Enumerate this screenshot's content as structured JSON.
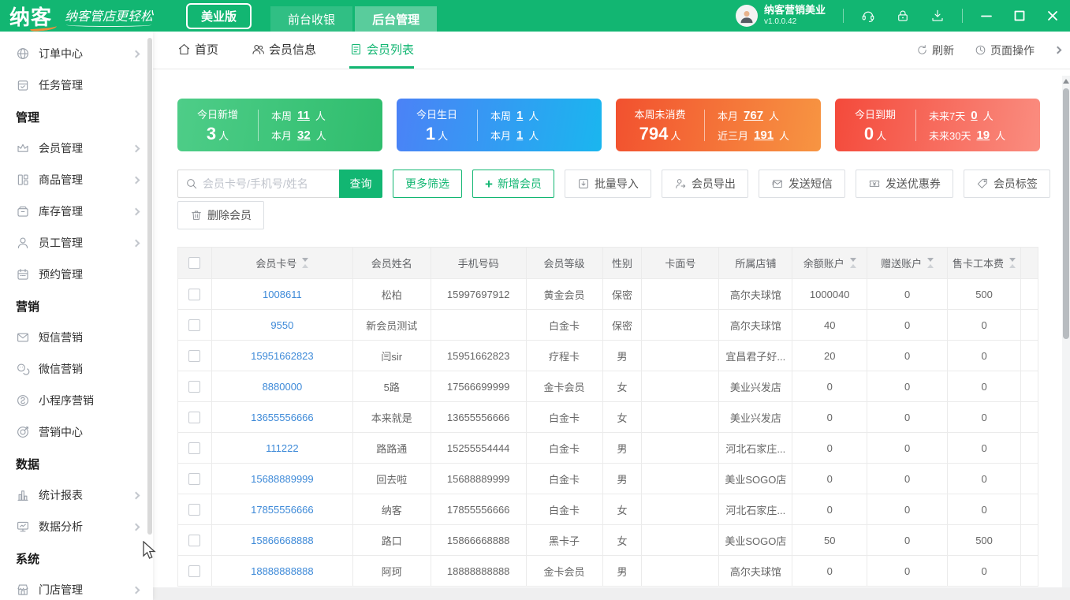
{
  "header": {
    "logo": "纳客",
    "slogan": "纳客管店更轻松",
    "edition_badge": "美业版",
    "nav_tabs": [
      {
        "label": "前台收银",
        "active": false
      },
      {
        "label": "后台管理",
        "active": true
      }
    ],
    "user": {
      "name": "纳客营销美业",
      "version": "v1.0.0.42"
    }
  },
  "sidebar": {
    "items": [
      {
        "label": "订单中心",
        "icon": "globe-icon",
        "type": "item",
        "arrow": true
      },
      {
        "label": "任务管理",
        "icon": "task-icon",
        "type": "item",
        "arrow": false
      },
      {
        "label": "管理",
        "type": "section"
      },
      {
        "label": "会员管理",
        "icon": "crown-icon",
        "type": "item",
        "arrow": true
      },
      {
        "label": "商品管理",
        "icon": "goods-icon",
        "type": "item",
        "arrow": true
      },
      {
        "label": "库存管理",
        "icon": "inventory-icon",
        "type": "item",
        "arrow": true
      },
      {
        "label": "员工管理",
        "icon": "person-icon",
        "type": "item",
        "arrow": true
      },
      {
        "label": "预约管理",
        "icon": "calendar-icon",
        "type": "item",
        "arrow": false
      },
      {
        "label": "营销",
        "type": "section"
      },
      {
        "label": "短信营销",
        "icon": "mail-icon",
        "type": "item",
        "arrow": false
      },
      {
        "label": "微信营销",
        "icon": "wechat-icon",
        "type": "item",
        "arrow": false
      },
      {
        "label": "小程序营销",
        "icon": "miniapp-icon",
        "type": "item",
        "arrow": false
      },
      {
        "label": "营销中心",
        "icon": "target-icon",
        "type": "item",
        "arrow": false
      },
      {
        "label": "数据",
        "type": "section"
      },
      {
        "label": "统计报表",
        "icon": "bar-chart-icon",
        "type": "item",
        "arrow": true
      },
      {
        "label": "数据分析",
        "icon": "monitor-icon",
        "type": "item",
        "arrow": true
      },
      {
        "label": "系统",
        "type": "section"
      },
      {
        "label": "门店管理",
        "icon": "shop-icon",
        "type": "item",
        "arrow": true
      }
    ]
  },
  "tabbar": {
    "tabs": [
      {
        "label": "首页",
        "active": false
      },
      {
        "label": "会员信息",
        "active": false
      },
      {
        "label": "会员列表",
        "active": true
      }
    ],
    "refresh_label": "刷新",
    "page_ops_label": "页面操作"
  },
  "stat_cards": [
    {
      "main_label": "今日新增",
      "main_value": "3",
      "unit": "人",
      "sub": [
        {
          "label": "本周",
          "value": "11",
          "unit": "人"
        },
        {
          "label": "本月",
          "value": "32",
          "unit": "人"
        }
      ]
    },
    {
      "main_label": "今日生日",
      "main_value": "1",
      "unit": "人",
      "sub": [
        {
          "label": "本周",
          "value": "1",
          "unit": "人"
        },
        {
          "label": "本月",
          "value": "1",
          "unit": "人"
        }
      ]
    },
    {
      "main_label": "本周未消费",
      "main_value": "794",
      "unit": "人",
      "sub": [
        {
          "label": "本月",
          "value": "767",
          "unit": "人"
        },
        {
          "label": "近三月",
          "value": "191",
          "unit": "人"
        }
      ]
    },
    {
      "main_label": "今日到期",
      "main_value": "0",
      "unit": "人",
      "sub": [
        {
          "label": "未来7天",
          "value": "0",
          "unit": "人"
        },
        {
          "label": "未来30天",
          "value": "19",
          "unit": "人"
        }
      ]
    }
  ],
  "toolbar": {
    "search_placeholder": "会员卡号/手机号/姓名",
    "search_label": "查询",
    "more_filter_label": "更多筛选",
    "add_member_label": "新增会员",
    "batch_import_label": "批量导入",
    "export_label": "会员导出",
    "send_sms_label": "发送短信",
    "send_coupon_label": "发送优惠券",
    "member_tag_label": "会员标签",
    "delete_label": "删除会员"
  },
  "table": {
    "columns": [
      "会员卡号",
      "会员姓名",
      "手机号码",
      "会员等级",
      "性别",
      "卡面号",
      "所属店铺",
      "余额账户",
      "赠送账户",
      "售卡工本费"
    ],
    "rows": [
      {
        "card_no": "1008611",
        "name": "松柏",
        "phone": "15997697912",
        "level": "黄金会员",
        "gender": "保密",
        "card_face": "",
        "store": "高尔夫球馆",
        "balance": "1000040",
        "gift": "0",
        "card_fee": "500"
      },
      {
        "card_no": "9550",
        "name": "新会员测试",
        "phone": "",
        "level": "白金卡",
        "gender": "保密",
        "card_face": "",
        "store": "高尔夫球馆",
        "balance": "40",
        "gift": "0",
        "card_fee": "0"
      },
      {
        "card_no": "15951662823",
        "name": "闫sir",
        "phone": "15951662823",
        "level": "疗程卡",
        "gender": "男",
        "card_face": "",
        "store": "宜昌君子好...",
        "balance": "20",
        "gift": "0",
        "card_fee": "0"
      },
      {
        "card_no": "8880000",
        "name": "5路",
        "phone": "17566699999",
        "level": "金卡会员",
        "gender": "女",
        "card_face": "",
        "store": "美业兴发店",
        "balance": "0",
        "gift": "0",
        "card_fee": "0"
      },
      {
        "card_no": "13655556666",
        "name": "本来就是",
        "phone": "13655556666",
        "level": "白金卡",
        "gender": "女",
        "card_face": "",
        "store": "美业兴发店",
        "balance": "0",
        "gift": "0",
        "card_fee": "0"
      },
      {
        "card_no": "111222",
        "name": "路路通",
        "phone": "15255554444",
        "level": "白金卡",
        "gender": "男",
        "card_face": "",
        "store": "河北石家庄...",
        "balance": "0",
        "gift": "0",
        "card_fee": "0"
      },
      {
        "card_no": "15688889999",
        "name": "回去啦",
        "phone": "15688889999",
        "level": "白金卡",
        "gender": "男",
        "card_face": "",
        "store": "美业SOGO店",
        "balance": "0",
        "gift": "0",
        "card_fee": "0"
      },
      {
        "card_no": "17855556666",
        "name": "纳客",
        "phone": "17855556666",
        "level": "白金卡",
        "gender": "女",
        "card_face": "",
        "store": "河北石家庄...",
        "balance": "0",
        "gift": "0",
        "card_fee": "0"
      },
      {
        "card_no": "15866668888",
        "name": "路口",
        "phone": "15866668888",
        "level": "黑卡子",
        "gender": "女",
        "card_face": "",
        "store": "美业SOGO店",
        "balance": "50",
        "gift": "0",
        "card_fee": "500"
      },
      {
        "card_no": "18888888888",
        "name": "阿珂",
        "phone": "18888888888",
        "level": "金卡会员",
        "gender": "男",
        "card_face": "",
        "store": "高尔夫球馆",
        "balance": "0",
        "gift": "0",
        "card_fee": "0"
      }
    ]
  },
  "colors": {
    "brand_green": "#12b672",
    "link_blue": "#3e8ad8",
    "card_green_from": "#4ecd88",
    "card_green_to": "#2fbd6d",
    "card_blue_from": "#4b82f6",
    "card_blue_to": "#1ab6ef",
    "card_orange_from": "#f2512f",
    "card_orange_to": "#f79542",
    "card_red_from": "#f44a3b",
    "card_red_to": "#fa8d80"
  }
}
